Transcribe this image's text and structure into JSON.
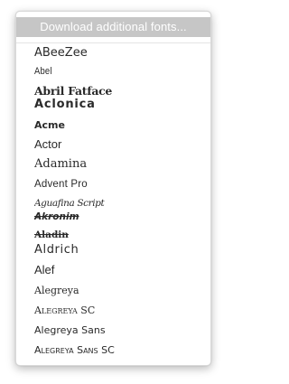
{
  "menu": {
    "header_label": "Download additional fonts...",
    "fonts": [
      "ABeeZee",
      "Abel",
      "Abril Fatface",
      "Aclonica",
      "Acme",
      "Actor",
      "Adamina",
      "Advent Pro",
      "Aguafina Script",
      "Akronim",
      "Aladin",
      "Aldrich",
      "Alef",
      "Alegreya",
      "Alegreya SC",
      "Alegreya Sans",
      "Alegreya Sans SC"
    ]
  },
  "colors": {
    "header_background": "#c6c6c6",
    "header_text": "#ffffff",
    "item_text": "#2a2a2a",
    "menu_background": "#ffffff"
  }
}
